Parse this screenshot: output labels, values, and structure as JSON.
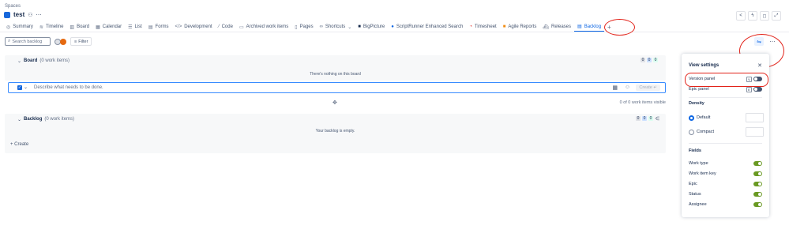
{
  "header": {
    "breadcrumb": "Spaces",
    "project_name": "test"
  },
  "tabs": [
    {
      "label": "Summary",
      "icon": "globe-icon"
    },
    {
      "label": "Timeline",
      "icon": "timeline-icon"
    },
    {
      "label": "Board",
      "icon": "board-icon"
    },
    {
      "label": "Calendar",
      "icon": "calendar-icon"
    },
    {
      "label": "List",
      "icon": "list-icon"
    },
    {
      "label": "Forms",
      "icon": "forms-icon"
    },
    {
      "label": "Development",
      "icon": "code-brackets-icon"
    },
    {
      "label": "Code",
      "icon": "code-icon"
    },
    {
      "label": "Archived work items",
      "icon": "archive-icon"
    },
    {
      "label": "Pages",
      "icon": "pages-icon"
    },
    {
      "label": "Shortcuts",
      "icon": "link-icon"
    },
    {
      "label": "BigPicture",
      "icon": "bigpicture-icon"
    },
    {
      "label": "ScriptRunner Enhanced Search",
      "icon": "scriptrunner-icon"
    },
    {
      "label": "Timesheet",
      "icon": "timesheet-icon"
    },
    {
      "label": "Agile Reports",
      "icon": "agile-reports-icon"
    },
    {
      "label": "Releases",
      "icon": "ship-icon"
    },
    {
      "label": "Backlog",
      "icon": "backlog-icon"
    }
  ],
  "toolbar": {
    "search_placeholder": "Search backlog",
    "filter_label": "Filter"
  },
  "board": {
    "title": "Board",
    "count": "(0 work items)",
    "empty_text": "There's nothing on this board",
    "counts": [
      "0",
      "0",
      "0"
    ]
  },
  "create_inline": {
    "placeholder": "Describe what needs to be done.",
    "button_label": "Create ↵"
  },
  "visible_count": "0 of 0 work items visible",
  "backlog": {
    "title": "Backlog",
    "count": "(0 work items)",
    "empty_text": "Your backlog is empty.",
    "counts": [
      "0",
      "0",
      "0"
    ],
    "create_label": "+ Create"
  },
  "view_settings": {
    "title": "View settings",
    "version_panel": "Version panel",
    "version_key": "V",
    "version_panel_on": false,
    "epic_panel": "Epic panel",
    "epic_key": "E",
    "epic_panel_on": false,
    "density_title": "Density",
    "density_default": "Default",
    "density_compact": "Compact",
    "density_selected": "Default",
    "fields_title": "Fields",
    "fields": [
      {
        "label": "Work type",
        "on": true
      },
      {
        "label": "Work item key",
        "on": true
      },
      {
        "label": "Epic",
        "on": true
      },
      {
        "label": "Status",
        "on": true
      },
      {
        "label": "Assignee",
        "on": true
      }
    ]
  },
  "colors": {
    "accent": "#0c66e4",
    "toggle_on": "#6a9a23",
    "annotation": "#e2231a"
  }
}
